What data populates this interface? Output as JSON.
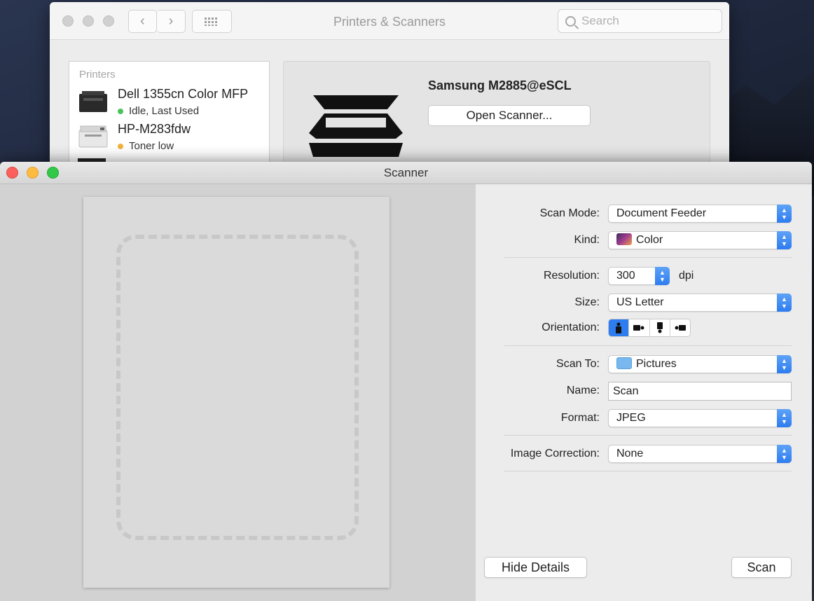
{
  "printers_window": {
    "title": "Printers & Scanners",
    "search_placeholder": "Search",
    "nav_back_glyph": "‹",
    "nav_forward_glyph": "›",
    "list_header": "Printers",
    "printers": [
      {
        "name": "Dell 1355cn Color MFP",
        "status": "Idle, Last Used",
        "status_color": "#4cc25a"
      },
      {
        "name": "HP-M283fdw",
        "status": "Toner low",
        "status_color": "#f0b23c"
      }
    ],
    "selected_device": "Samsung M2885@eSCL",
    "open_scanner_label": "Open Scanner..."
  },
  "scanner_window": {
    "title": "Scanner",
    "scan_mode_label": "Scan Mode:",
    "scan_mode_value": "Document Feeder",
    "kind_label": "Kind:",
    "kind_value": "Color",
    "resolution_label": "Resolution:",
    "resolution_value": "300",
    "resolution_unit": "dpi",
    "size_label": "Size:",
    "size_value": "US Letter",
    "orientation_label": "Orientation:",
    "scan_to_label": "Scan To:",
    "scan_to_value": "Pictures",
    "name_label": "Name:",
    "name_value": "Scan",
    "format_label": "Format:",
    "format_value": "JPEG",
    "image_correction_label": "Image Correction:",
    "image_correction_value": "None",
    "hide_details_label": "Hide Details",
    "scan_label": "Scan"
  },
  "colors": {
    "accent": "#2d7cf0"
  }
}
